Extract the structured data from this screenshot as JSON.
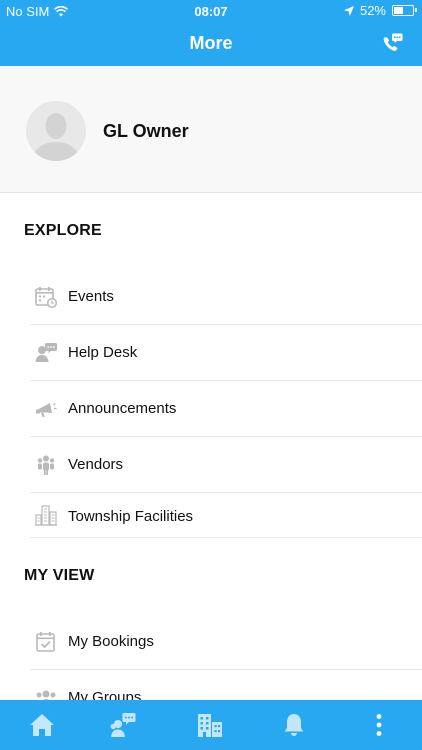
{
  "status_bar": {
    "carrier": "No SIM",
    "time": "08:07",
    "battery_percent_label": "52%",
    "battery_level": 0.52,
    "icons": [
      "wifi-icon",
      "location-arrow-icon",
      "battery-icon"
    ]
  },
  "header": {
    "title": "More",
    "call_icon": "phone-chat-icon"
  },
  "profile": {
    "name": "GL Owner",
    "avatar_icon": "avatar-placeholder"
  },
  "explore": {
    "title": "EXPLORE",
    "items": [
      {
        "label": "Events",
        "icon": "calendar-icon"
      },
      {
        "label": "Help Desk",
        "icon": "helpdesk-icon"
      },
      {
        "label": "Announcements",
        "icon": "megaphone-icon"
      },
      {
        "label": "Vendors",
        "icon": "vendors-icon"
      },
      {
        "label": "Township Facilities",
        "icon": "buildings-icon"
      }
    ]
  },
  "my_view": {
    "title": "MY VIEW",
    "items": [
      {
        "label": "My Bookings",
        "icon": "calendar-check-icon"
      },
      {
        "label": "My Groups",
        "icon": "groups-icon"
      }
    ]
  },
  "tab_bar": {
    "items": [
      "home-icon",
      "community-chat-icon",
      "buildings-icon",
      "bell-icon",
      "more-vertical-icon"
    ]
  },
  "colors": {
    "primary": "#29a8f2",
    "icon_gray": "#b9b9b9",
    "divider": "#e9e9e9"
  }
}
